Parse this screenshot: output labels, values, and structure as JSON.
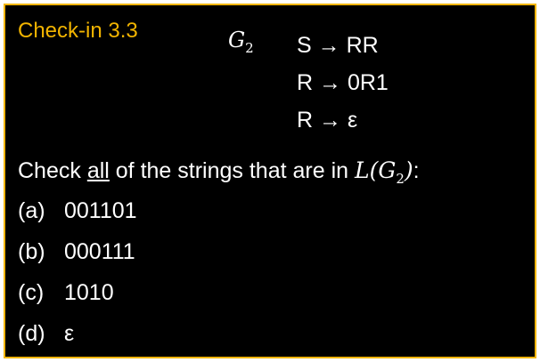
{
  "title": "Check-in 3.3",
  "grammar": {
    "name": "G",
    "name_sub": "2",
    "rules": [
      {
        "lhs": "S",
        "arrow": "→",
        "rhs": "RR"
      },
      {
        "lhs": "R",
        "arrow": "→",
        "rhs": "0R1"
      },
      {
        "lhs": "R",
        "arrow": "→",
        "rhs": "ε"
      }
    ]
  },
  "question": {
    "before": "Check ",
    "emph": "all",
    "middle": " of the strings that are in ",
    "lang_L": "L",
    "lang_open": "(",
    "lang_G": "G",
    "lang_sub": "2",
    "lang_close": ")",
    "after": ":"
  },
  "options": [
    {
      "letter": "(a)",
      "value": "001101"
    },
    {
      "letter": "(b)",
      "value": "000111"
    },
    {
      "letter": "(c)",
      "value": "1010"
    },
    {
      "letter": "(d)",
      "value": "ε"
    }
  ],
  "colors": {
    "accent": "#f2b400",
    "background": "#000000",
    "text": "#ffffff"
  }
}
